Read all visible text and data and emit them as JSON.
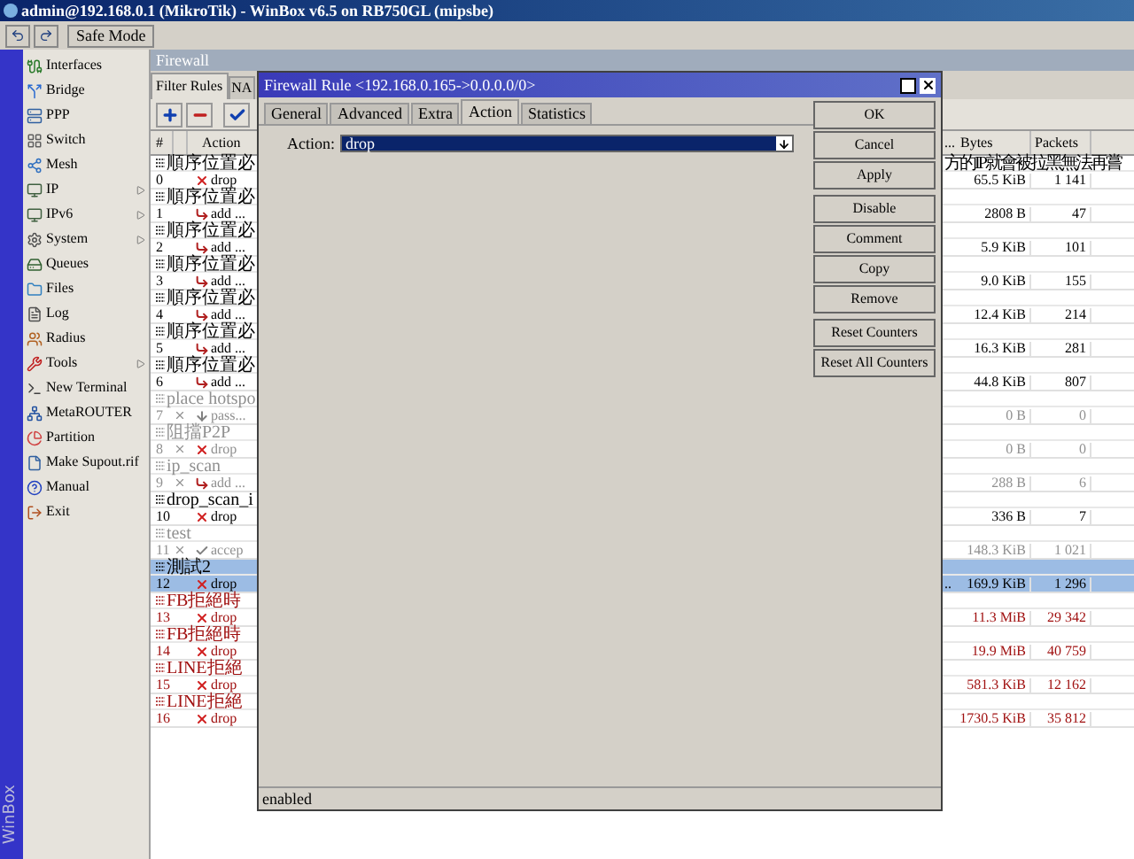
{
  "window": {
    "title": "admin@192.168.0.1 (MikroTik) - WinBox v6.5 on RB750GL (mipsbe)"
  },
  "toolbar": {
    "safe_mode": "Safe Mode"
  },
  "side_label": "WinBox",
  "sidebar": {
    "items": [
      {
        "label": "Interfaces",
        "submenu": false
      },
      {
        "label": "Bridge",
        "submenu": false
      },
      {
        "label": "PPP",
        "submenu": false
      },
      {
        "label": "Switch",
        "submenu": false
      },
      {
        "label": "Mesh",
        "submenu": false
      },
      {
        "label": "IP",
        "submenu": true
      },
      {
        "label": "IPv6",
        "submenu": true
      },
      {
        "label": "System",
        "submenu": true
      },
      {
        "label": "Queues",
        "submenu": false
      },
      {
        "label": "Files",
        "submenu": false
      },
      {
        "label": "Log",
        "submenu": false
      },
      {
        "label": "Radius",
        "submenu": false
      },
      {
        "label": "Tools",
        "submenu": true
      },
      {
        "label": "New Terminal",
        "submenu": false
      },
      {
        "label": "MetaROUTER",
        "submenu": false
      },
      {
        "label": "Partition",
        "submenu": false
      },
      {
        "label": "Make Supout.rif",
        "submenu": false
      },
      {
        "label": "Manual",
        "submenu": false
      },
      {
        "label": "Exit",
        "submenu": false
      }
    ]
  },
  "firewall": {
    "title": "Firewall",
    "tabs": [
      {
        "label": "Filter Rules",
        "selected": true
      },
      {
        "label": "NA",
        "selected": false
      }
    ],
    "table": {
      "columns": [
        "#",
        "Action",
        "...",
        "Bytes",
        "Packets"
      ],
      "rows": [
        {
          "comment": "順序位置必",
          "comment_right": "方的IP就會被拉黑無法再嘗",
          "number": "0",
          "disabled": false,
          "selected": false,
          "color": "#000000",
          "kind": "drop",
          "action": "drop",
          "bytes": "65.5 KiB",
          "packets": "1 141"
        },
        {
          "comment": "順序位置必",
          "number": "1",
          "disabled": false,
          "selected": false,
          "color": "#000000",
          "kind": "add",
          "action": "add ...",
          "bytes": "2808 B",
          "packets": "47"
        },
        {
          "comment": "順序位置必",
          "number": "2",
          "disabled": false,
          "selected": false,
          "color": "#000000",
          "kind": "add",
          "action": "add ...",
          "bytes": "5.9 KiB",
          "packets": "101"
        },
        {
          "comment": "順序位置必",
          "number": "3",
          "disabled": false,
          "selected": false,
          "color": "#000000",
          "kind": "add",
          "action": "add ...",
          "bytes": "9.0 KiB",
          "packets": "155"
        },
        {
          "comment": "順序位置必",
          "number": "4",
          "disabled": false,
          "selected": false,
          "color": "#000000",
          "kind": "add",
          "action": "add ...",
          "bytes": "12.4 KiB",
          "packets": "214"
        },
        {
          "comment": "順序位置必",
          "number": "5",
          "disabled": false,
          "selected": false,
          "color": "#000000",
          "kind": "add",
          "action": "add ...",
          "bytes": "16.3 KiB",
          "packets": "281"
        },
        {
          "comment": "順序位置必",
          "number": "6",
          "disabled": false,
          "selected": false,
          "color": "#000000",
          "kind": "add",
          "action": "add ...",
          "bytes": "44.8 KiB",
          "packets": "807"
        },
        {
          "comment": "place hotspo",
          "number": "7",
          "disabled": true,
          "selected": false,
          "kind": "pass",
          "action": "pass...",
          "bytes": "0 B",
          "packets": "0"
        },
        {
          "comment": "阻擋P2P",
          "number": "8",
          "disabled": true,
          "selected": false,
          "kind": "drop",
          "action": "drop",
          "bytes": "0 B",
          "packets": "0"
        },
        {
          "comment": "ip_scan",
          "number": "9",
          "disabled": true,
          "selected": false,
          "kind": "add",
          "action": "add ...",
          "bytes": "288 B",
          "packets": "6"
        },
        {
          "comment": "drop_scan_i",
          "number": "10",
          "disabled": false,
          "selected": false,
          "color": "#000000",
          "kind": "drop",
          "action": "drop",
          "bytes": "336 B",
          "packets": "7"
        },
        {
          "comment": "test",
          "number": "11",
          "disabled": true,
          "selected": false,
          "kind": "accept",
          "action": "accep",
          "bytes": "148.3 KiB",
          "packets": "1 021"
        },
        {
          "comment": "測試2",
          "number": "12",
          "disabled": false,
          "selected": true,
          "color": "#000000",
          "kind": "drop",
          "action": "drop",
          "extra": "..",
          "bytes": "169.9 KiB",
          "packets": "1 296"
        },
        {
          "comment": "FB拒絕時",
          "number": "13",
          "disabled": false,
          "selected": false,
          "color": "#a01010",
          "kind": "drop",
          "action": "drop",
          "bytes": "11.3 MiB",
          "packets": "29 342"
        },
        {
          "comment": "FB拒絕時",
          "number": "14",
          "disabled": false,
          "selected": false,
          "color": "#a01010",
          "kind": "drop",
          "action": "drop",
          "bytes": "19.9 MiB",
          "packets": "40 759"
        },
        {
          "comment": "LINE拒絕",
          "number": "15",
          "disabled": false,
          "selected": false,
          "color": "#a01010",
          "kind": "drop",
          "action": "drop",
          "bytes": "581.3 KiB",
          "packets": "12 162"
        },
        {
          "comment": "LINE拒絕",
          "number": "16",
          "disabled": false,
          "selected": false,
          "color": "#a01010",
          "kind": "drop",
          "action": "drop",
          "bytes": "1730.5 KiB",
          "packets": "35 812"
        }
      ]
    }
  },
  "dialog": {
    "title": "Firewall Rule <192.168.0.165->0.0.0.0/0>",
    "tabs": [
      {
        "label": "General",
        "selected": false
      },
      {
        "label": "Advanced",
        "selected": false
      },
      {
        "label": "Extra",
        "selected": false
      },
      {
        "label": "Action",
        "selected": true
      },
      {
        "label": "Statistics",
        "selected": false
      }
    ],
    "field": {
      "label": "Action:",
      "value": "drop"
    },
    "button_groups": [
      [
        "OK",
        "Cancel",
        "Apply"
      ],
      [
        "Disable",
        "Comment",
        "Copy",
        "Remove"
      ],
      [
        "Reset Counters",
        "Reset All Counters"
      ]
    ],
    "status": "enabled"
  }
}
